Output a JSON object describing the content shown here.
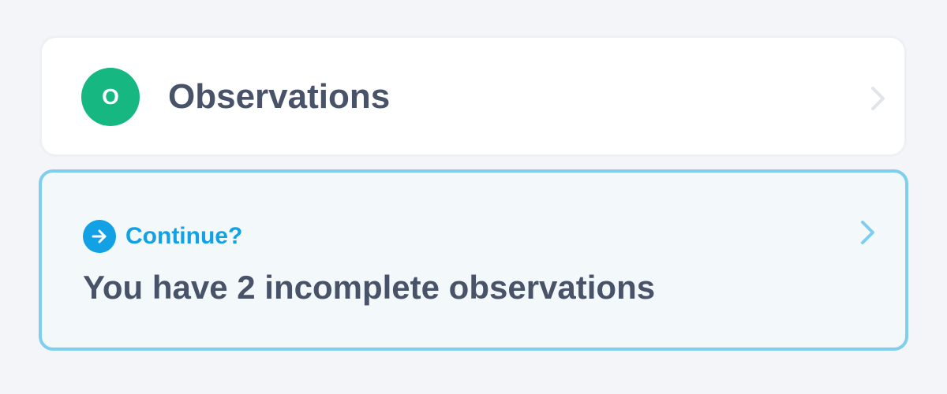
{
  "observations_card": {
    "avatar_letter": "O",
    "avatar_color": "#16b781",
    "title": "Observations",
    "chevron_icon": "chevron-right-icon"
  },
  "continue_card": {
    "icon": "arrow-right-circle-icon",
    "label": "Continue?",
    "message": "You have 2 incomplete observations",
    "accent_color": "#12a1e4",
    "border_color": "#7fcef0",
    "chevron_icon": "chevron-right-icon"
  }
}
